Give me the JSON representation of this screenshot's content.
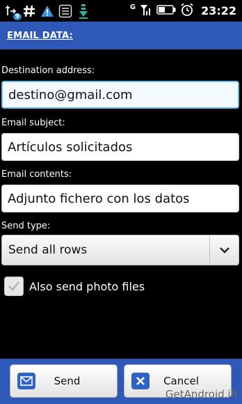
{
  "status_bar": {
    "time": "23:22",
    "network_label": "G",
    "notification_count": "9",
    "icons": [
      "usb-icon",
      "hash-icon",
      "warning-icon",
      "list-icon",
      "download-icon",
      "signal-icon",
      "battery-icon",
      "alarm-icon"
    ]
  },
  "header": {
    "title": "EMAIL DATA:"
  },
  "form": {
    "destination_label": "Destination address:",
    "destination_value": "destino@gmail.com",
    "subject_label": "Email subject:",
    "subject_value": "Artículos solicitados",
    "contents_label": "Email contents:",
    "contents_value": "Adjunto fichero con los datos",
    "send_type_label": "Send type:",
    "send_type_value": "Send all rows",
    "photo_checkbox_label": "Also send photo files",
    "photo_checkbox_checked": true
  },
  "footer": {
    "send_label": "Send",
    "cancel_label": "Cancel"
  },
  "watermark": "GetAndroid.iR",
  "colors": {
    "header": "#2f59b8",
    "focus_border": "#6fc0e8",
    "button_icon": "#2f63c5"
  }
}
